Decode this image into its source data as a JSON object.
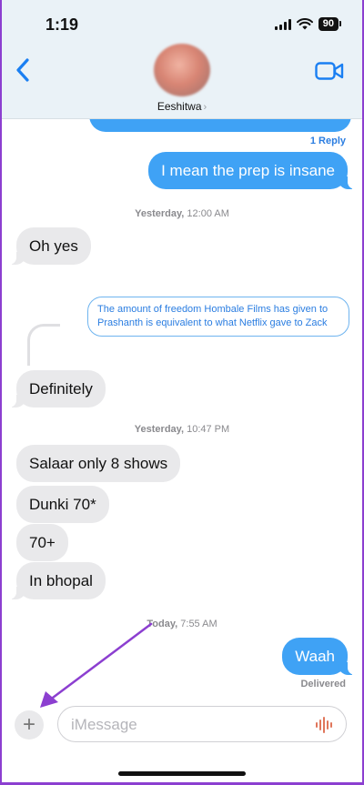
{
  "status_bar": {
    "time": "1:19",
    "battery": "90"
  },
  "header": {
    "contact_name": "Eeshitwa",
    "chevron": "›"
  },
  "thread": {
    "reply_count": "1 Reply"
  },
  "messages": {
    "m1": "I mean the prep is insane",
    "ts1_day": "Yesterday,",
    "ts1_time": "12:00 AM",
    "m2": "Oh yes",
    "quoted": "The amount of freedom Hombale Films has given to Prashanth is equivalent to what Netflix gave to Zack",
    "m3": "Definitely",
    "ts2_day": "Yesterday,",
    "ts2_time": "10:47 PM",
    "m4": "Salaar only 8 shows",
    "m5": "Dunki 70*",
    "m6": "70+",
    "m7": "In bhopal",
    "ts3_day": "Today,",
    "ts3_time": "7:55 AM",
    "m8": "Waah",
    "delivered": "Delivered"
  },
  "composer": {
    "placeholder": "iMessage",
    "plus": "+"
  },
  "icons": {
    "back": "chevron-left-icon",
    "video": "video-camera-icon",
    "mic": "audio-waveform-icon",
    "annotation": "arrow-icon"
  },
  "colors": {
    "accent": "#3fa2f5",
    "annotation_arrow": "#8c3fd0"
  }
}
